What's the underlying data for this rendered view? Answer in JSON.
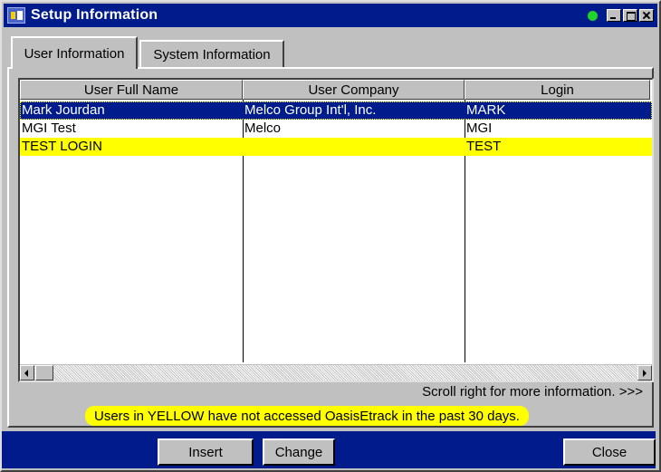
{
  "window": {
    "title": "Setup Information"
  },
  "tabs": [
    {
      "label": "User Information",
      "active": true
    },
    {
      "label": "System Information",
      "active": false
    }
  ],
  "grid": {
    "columns": [
      "User Full Name",
      "User Company",
      "Login"
    ],
    "rows": [
      {
        "full_name": "Mark Jourdan",
        "company": "Melco Group Int'l, Inc.",
        "login": "MARK",
        "state": "selected"
      },
      {
        "full_name": "MGI Test",
        "company": "Melco",
        "login": "MGI",
        "state": "normal"
      },
      {
        "full_name": "TEST LOGIN",
        "company": "",
        "login": "TEST",
        "state": "yellow"
      }
    ]
  },
  "scroll_hint": "Scroll right for more information. >>>",
  "notice": "Users in YELLOW have not accessed OasisEtrack in the past 30 days.",
  "buttons": {
    "insert": "Insert",
    "change": "Change",
    "close": "Close"
  },
  "colors": {
    "titlebar": "#001b8c",
    "selection": "#001b8c",
    "highlight_yellow": "#ffff00",
    "status_indicator": "#21d42a"
  },
  "icons": [
    "app-icon",
    "status-indicator-icon",
    "minimize-icon",
    "maximize-icon",
    "close-icon",
    "scroll-left-icon",
    "scroll-right-icon"
  ]
}
